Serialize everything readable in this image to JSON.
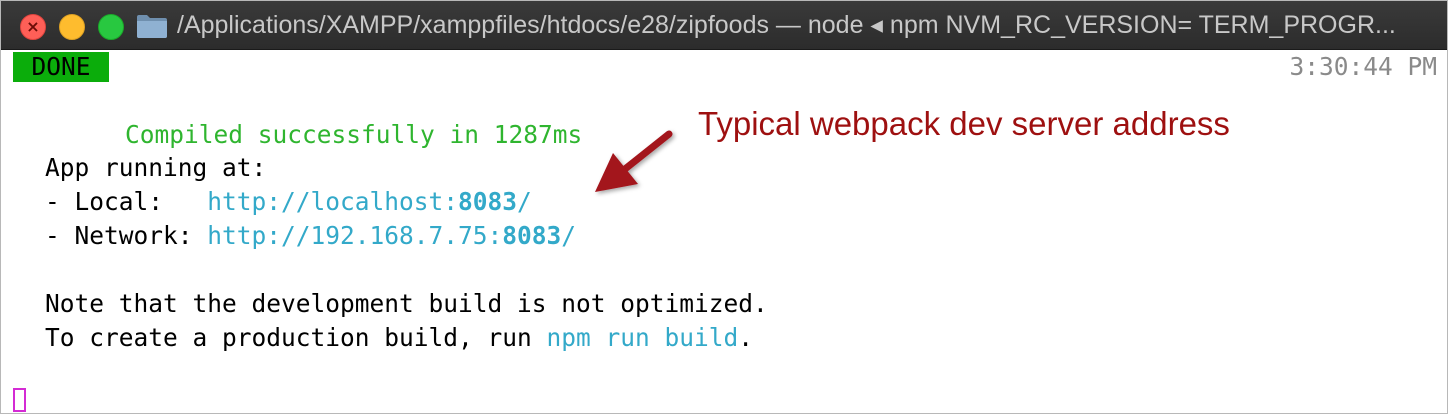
{
  "window": {
    "title": "/Applications/XAMPP/xamppfiles/htdocs/e28/zipfoods — node ◂ npm NVM_RC_VERSION= TERM_PROGR..."
  },
  "terminal": {
    "status_badge": "DONE",
    "status_message": "Compiled successfully in 1287ms",
    "timestamp": "3:30:44 PM",
    "app_running_label": "App running at:",
    "local_prefix": "- Local:   ",
    "local_url_base": "http://localhost:",
    "local_port": "8083",
    "local_url_suffix": "/",
    "network_prefix": "- Network: ",
    "network_url_base": "http://192.168.7.75:",
    "network_port": "8083",
    "network_url_suffix": "/",
    "note_line": "Note that the development build is not optimized.",
    "prod_prefix": "To create a production build, run ",
    "prod_command": "npm run build",
    "prod_suffix": "."
  },
  "annotation": {
    "text": "Typical webpack dev server address",
    "color": "#9e1010"
  },
  "colors": {
    "done_bg": "#0bad0b",
    "success_text": "#2fb52f",
    "url_text": "#33a9c9",
    "cursor": "#d42bd4"
  },
  "icons": [
    "close-icon",
    "minimize-icon",
    "zoom-icon",
    "folder-icon",
    "arrow-icon",
    "cursor-icon"
  ]
}
